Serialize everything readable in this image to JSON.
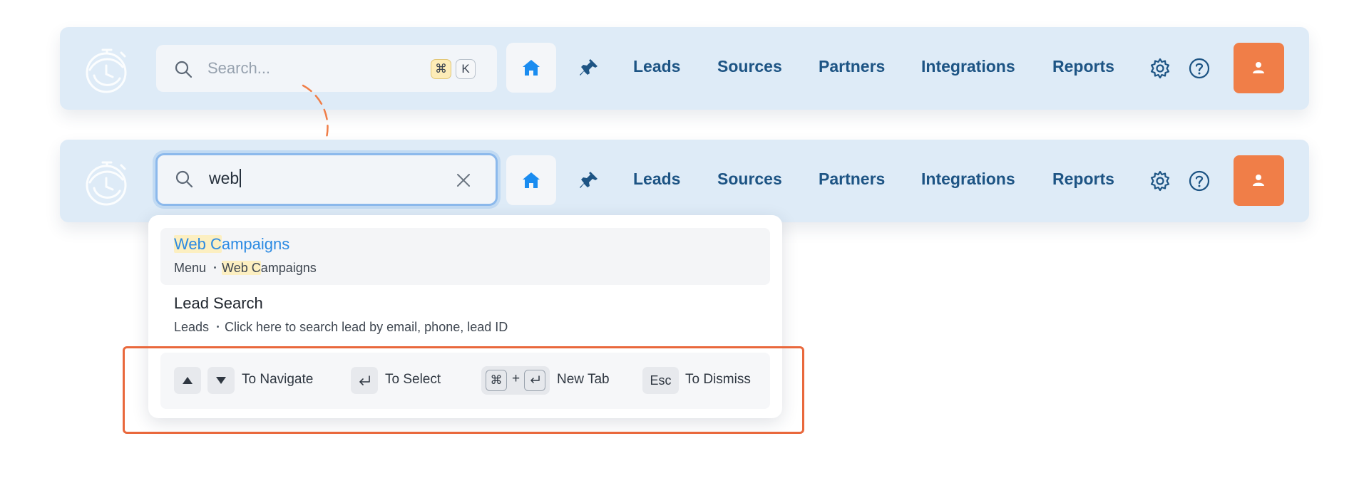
{
  "nav_bar_before": {
    "search_placeholder": "Search...",
    "shortcut_keys": [
      "⌘",
      "K"
    ],
    "links": [
      "Leads",
      "Sources",
      "Partners",
      "Integrations",
      "Reports"
    ]
  },
  "nav_bar_after": {
    "search_value": "web",
    "links": [
      "Leads",
      "Sources",
      "Partners",
      "Integrations",
      "Reports"
    ]
  },
  "results": [
    {
      "title_highlight": "Web C",
      "title_rest": "ampaigns",
      "section": "Menu",
      "path_highlight": "Web C",
      "path_rest": "ampaigns"
    },
    {
      "title": "Lead Search",
      "section": "Leads",
      "path": "Click here to search lead by email, phone, lead ID"
    }
  ],
  "hints": {
    "navigate": "To Navigate",
    "select": "To Select",
    "cmd_symbol": "⌘",
    "plus": "+",
    "new_tab": "New Tab",
    "esc": "Esc",
    "dismiss": "To Dismiss"
  },
  "colors": {
    "nav_background": "#deebf7",
    "nav_link": "#1d5484",
    "accent_orange": "#f07e48",
    "highlight_box": "#e9683c",
    "match_highlight": "#fcefc1",
    "result_link": "#2b8ae2",
    "home_icon": "#1a8cf0"
  },
  "icons": [
    "stopwatch-logo",
    "search-icon",
    "close-icon",
    "home-icon",
    "pin-icon",
    "gear-icon",
    "help-icon",
    "user-icon",
    "arrow-up-icon",
    "arrow-down-icon",
    "enter-icon"
  ]
}
